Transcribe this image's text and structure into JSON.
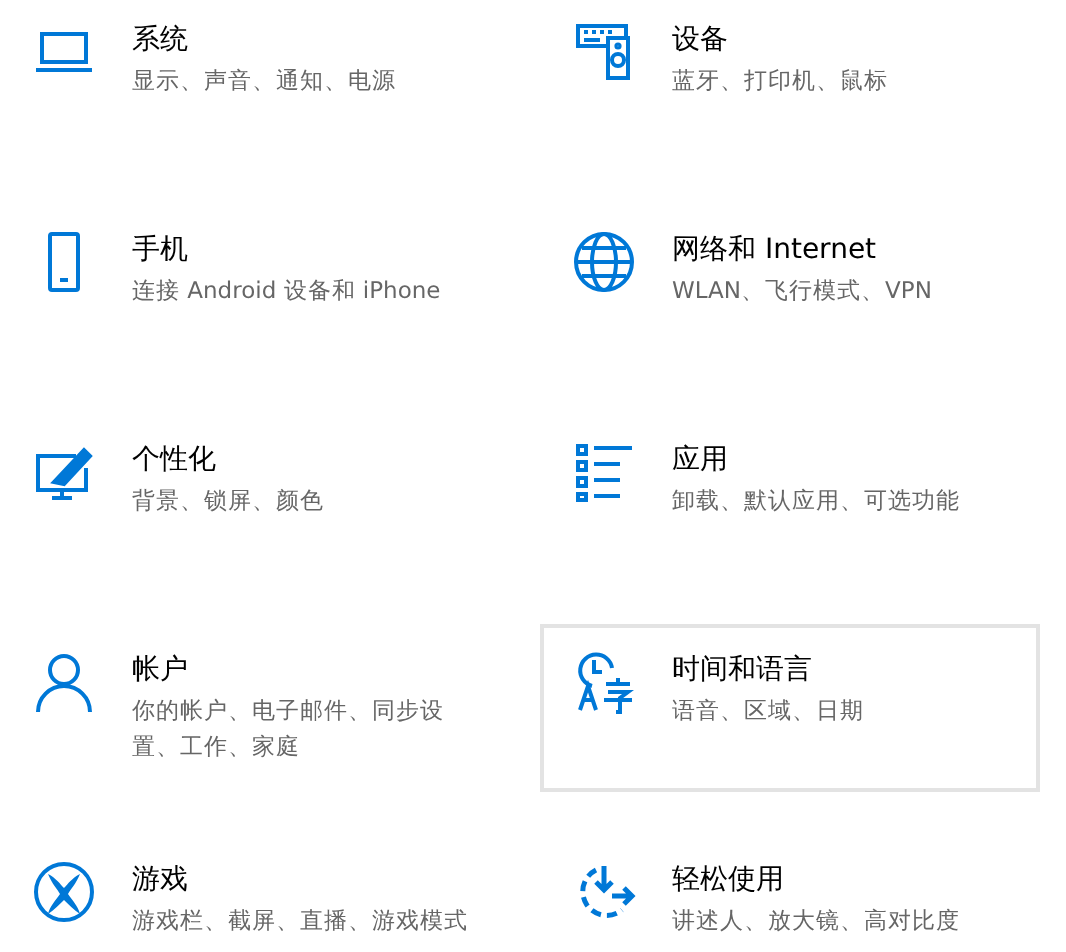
{
  "categories": [
    {
      "kind": "laptop",
      "title": "系统",
      "subtitle": "显示、声音、通知、电源",
      "hovered": false
    },
    {
      "kind": "devices",
      "title": "设备",
      "subtitle": "蓝牙、打印机、鼠标",
      "hovered": false
    },
    {
      "kind": "phone",
      "title": "手机",
      "subtitle": "连接 Android 设备和 iPhone",
      "hovered": false
    },
    {
      "kind": "globe",
      "title": "网络和 Internet",
      "subtitle": "WLAN、飞行模式、VPN",
      "hovered": false
    },
    {
      "kind": "paint",
      "title": "个性化",
      "subtitle": "背景、锁屏、颜色",
      "hovered": false
    },
    {
      "kind": "apps",
      "title": "应用",
      "subtitle": "卸载、默认应用、可选功能",
      "hovered": false
    },
    {
      "kind": "person",
      "title": "帐户",
      "subtitle": "你的帐户、电子邮件、同步设置、工作、家庭",
      "hovered": false
    },
    {
      "kind": "language",
      "title": "时间和语言",
      "subtitle": "语音、区域、日期",
      "hovered": true
    },
    {
      "kind": "xbox",
      "title": "游戏",
      "subtitle": "游戏栏、截屏、直播、游戏模式",
      "hovered": false
    },
    {
      "kind": "ease",
      "title": "轻松使用",
      "subtitle": "讲述人、放大镜、高对比度",
      "hovered": false
    }
  ]
}
